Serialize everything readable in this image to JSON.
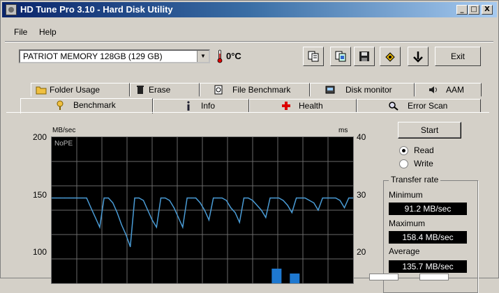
{
  "window": {
    "title": "HD Tune Pro 3.10 - Hard Disk Utility"
  },
  "title_buttons": {
    "minimize": "_",
    "maximize": "□",
    "close": "X"
  },
  "menu": [
    "File",
    "Help"
  ],
  "toolbar": {
    "drive": "PATRIOT MEMORY 128GB (129 GB)",
    "temperature": "0°C",
    "buttons": [
      {
        "icon": "copy-text-icon"
      },
      {
        "icon": "copy-screenshot-icon"
      },
      {
        "icon": "save-icon"
      },
      {
        "icon": "options-icon"
      },
      {
        "icon": "download-arrow-icon"
      }
    ],
    "exit_label": "Exit"
  },
  "tabs_row1": [
    {
      "label": "Folder Usage",
      "icon": "folder-icon"
    },
    {
      "label": "Erase",
      "icon": "trash-icon"
    },
    {
      "label": "File Benchmark",
      "icon": "file-benchmark-icon"
    },
    {
      "label": "Disk monitor",
      "icon": "disk-monitor-icon"
    },
    {
      "label": "AAM",
      "icon": "speaker-icon"
    }
  ],
  "tabs_row2": [
    {
      "label": "Benchmark",
      "icon": "benchmark-icon",
      "active": true
    },
    {
      "label": "Info",
      "icon": "info-icon"
    },
    {
      "label": "Health",
      "icon": "health-icon"
    },
    {
      "label": "Error Scan",
      "icon": "magnifier-icon"
    }
  ],
  "benchmark": {
    "start_label": "Start",
    "mode": {
      "read": "Read",
      "write": "Write",
      "selected": "read"
    },
    "transfer_rate": {
      "title": "Transfer rate",
      "minimum_label": "Minimum",
      "minimum_value": "91.2 MB/sec",
      "maximum_label": "Maximum",
      "maximum_value": "158.4 MB/sec",
      "average_label": "Average",
      "average_value": "135.7 MB/sec"
    }
  },
  "chart_data": {
    "type": "line",
    "ylabel_left": "MB/sec",
    "ylabel_right": "ms",
    "overlay_text": "NoPE",
    "left_ticks": [
      "200",
      "150",
      "100"
    ],
    "right_ticks": [
      "40",
      "30",
      "20"
    ],
    "ylim": [
      80,
      200
    ],
    "series": [
      {
        "color": "#4a9cd6",
        "values": [
          150,
          150,
          150,
          150,
          150,
          150,
          150,
          150,
          150,
          142,
          134,
          126,
          150,
          150,
          146,
          138,
          128,
          120,
          110,
          150,
          150,
          148,
          140,
          132,
          126,
          150,
          150,
          148,
          142,
          134,
          126,
          150,
          150,
          150,
          146,
          140,
          132,
          150,
          150,
          150,
          148,
          142,
          138,
          130,
          150,
          150,
          148,
          144,
          140,
          134,
          150,
          150,
          150,
          148,
          144,
          138,
          150,
          150,
          150,
          148,
          146,
          140,
          150,
          150,
          150,
          150,
          148,
          142,
          150,
          150
        ]
      }
    ],
    "bars": [
      {
        "x": 0.73,
        "value": 92
      },
      {
        "x": 0.79,
        "value": 88
      }
    ],
    "grid": true
  }
}
